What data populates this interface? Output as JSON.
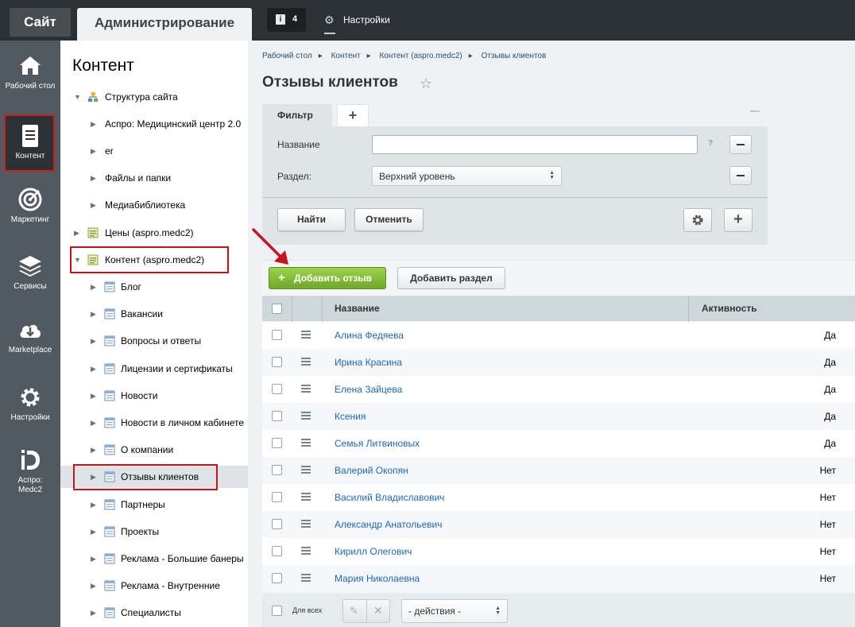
{
  "topbar": {
    "site_tab": "Сайт",
    "admin_tab": "Администрирование",
    "notifications_count": "4",
    "settings_label": "Настройки"
  },
  "rail": {
    "items": [
      {
        "label": "Рабочий стол",
        "icon": "home-icon"
      },
      {
        "label": "Контент",
        "icon": "document-icon"
      },
      {
        "label": "Маркетинг",
        "icon": "target-icon"
      },
      {
        "label": "Сервисы",
        "icon": "layers-icon"
      },
      {
        "label": "Marketplace",
        "icon": "cloud-download-icon"
      },
      {
        "label": "Настройки",
        "icon": "gear-icon"
      },
      {
        "label": "Аспро: Medc2",
        "icon": "aspro-logo-icon"
      }
    ]
  },
  "tree": {
    "title": "Контент",
    "items": [
      "Структура сайта",
      "Аспро: Медицинский центр 2.0",
      "er",
      "Файлы и папки",
      "Медиабиблиотека",
      "Цены (aspro.medc2)",
      "Контент (aspro.medc2)",
      "Блог",
      "Вакансии",
      "Вопросы и ответы",
      "Лицензии и сертификаты",
      "Новости",
      "Новости в личном кабинете",
      "О компании",
      "Отзывы клиентов",
      "Партнеры",
      "Проекты",
      "Реклама - Большие банеры",
      "Реклама - Внутренние",
      "Специалисты"
    ]
  },
  "breadcrumbs": [
    "Рабочий стол",
    "Контент",
    "Контент (aspro.medc2)",
    "Отзывы клиентов"
  ],
  "page_title": "Отзывы клиентов",
  "filter": {
    "tab_label": "Фильтр",
    "name_label": "Название",
    "name_value": "",
    "help": "?",
    "section_label": "Раздел:",
    "section_value": "Верхний уровень",
    "find_button": "Найти",
    "cancel_button": "Отменить"
  },
  "actions": {
    "add_review": "Добавить отзыв",
    "add_section": "Добавить раздел"
  },
  "table": {
    "columns": [
      "Название",
      "Активность"
    ],
    "rows": [
      {
        "name": "Алина Федяева",
        "active": "Да"
      },
      {
        "name": "Ирина Красина",
        "active": "Да"
      },
      {
        "name": "Елена Зайцева",
        "active": "Да"
      },
      {
        "name": "Ксения",
        "active": "Да"
      },
      {
        "name": "Семья Литвиновых",
        "active": "Да"
      },
      {
        "name": "Валерий Окопян",
        "active": "Нет"
      },
      {
        "name": "Василий Владиславович",
        "active": "Нет"
      },
      {
        "name": "Александр Анатольевич",
        "active": "Нет"
      },
      {
        "name": "Кирилл Олегович",
        "active": "Нет"
      },
      {
        "name": "Мария Николаевна",
        "active": "Нет"
      }
    ]
  },
  "footer": {
    "for_all": "Для всех",
    "actions_select": "- действия -"
  },
  "colors": {
    "accent_green": "#7ab537",
    "link_blue": "#2169b1",
    "highlight_red": "#c8131d",
    "topbar": "#2b3136",
    "rail": "#515a61"
  }
}
